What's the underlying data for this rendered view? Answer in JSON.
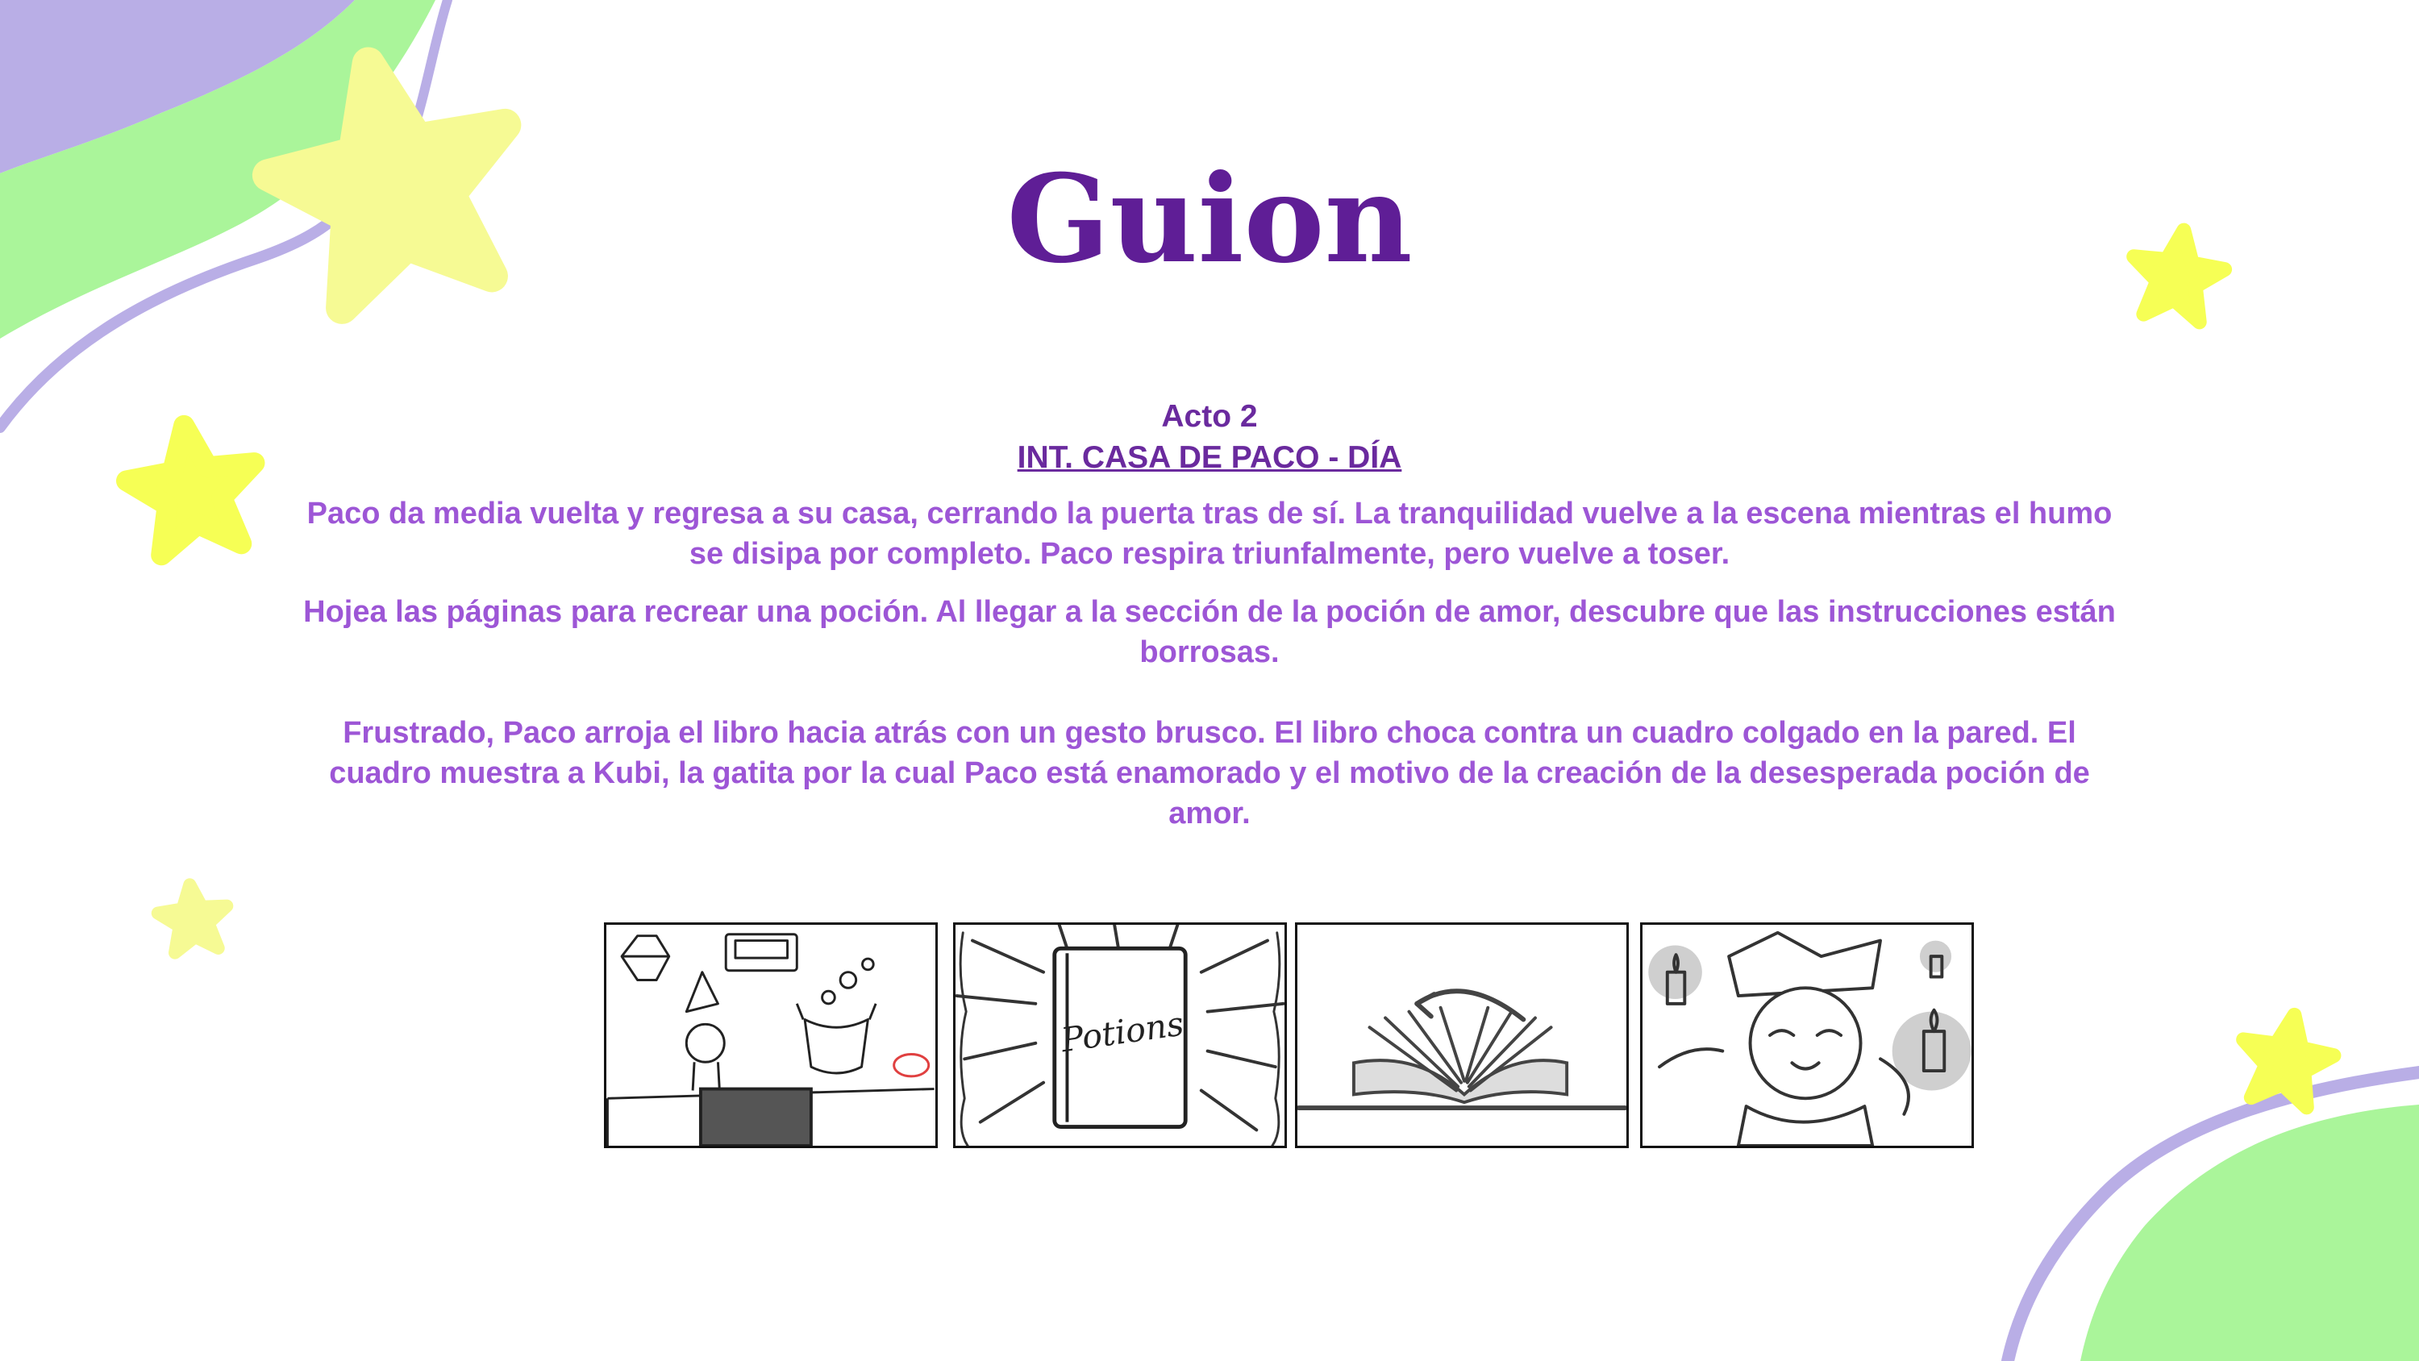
{
  "slide": {
    "title": "Guion",
    "act": "Acto 2",
    "scene_heading": "INT. CASA DE PACO - DÍA",
    "paragraphs": [
      "Paco da media vuelta y regresa a su casa, cerrando la puerta tras de sí. La tranquilidad vuelve a la escena mientras el humo se disipa por completo. Paco respira triunfalmente, pero vuelve a toser.",
      "Hojea las páginas para recrear una poción. Al llegar a la sección de la poción de amor, descubre que las instrucciones están borrosas.",
      "Frustrado, Paco arroja el libro hacia atrás con un gesto brusco. El libro choca contra un cuadro colgado en la pared. El cuadro muestra a Kubi, la gatita por la cual Paco está enamorado y el motivo de la creación de la desesperada poción de amor."
    ]
  },
  "storyboard": {
    "book_label": "Potions"
  },
  "colors": {
    "title": "#5f1e96",
    "heading": "#6a2a9e",
    "body": "#9d56d6",
    "lavender": "#b9aee6",
    "mint": "#aaf59a",
    "star_yellow": "#f6ff55",
    "star_pale": "#f6fa94"
  }
}
